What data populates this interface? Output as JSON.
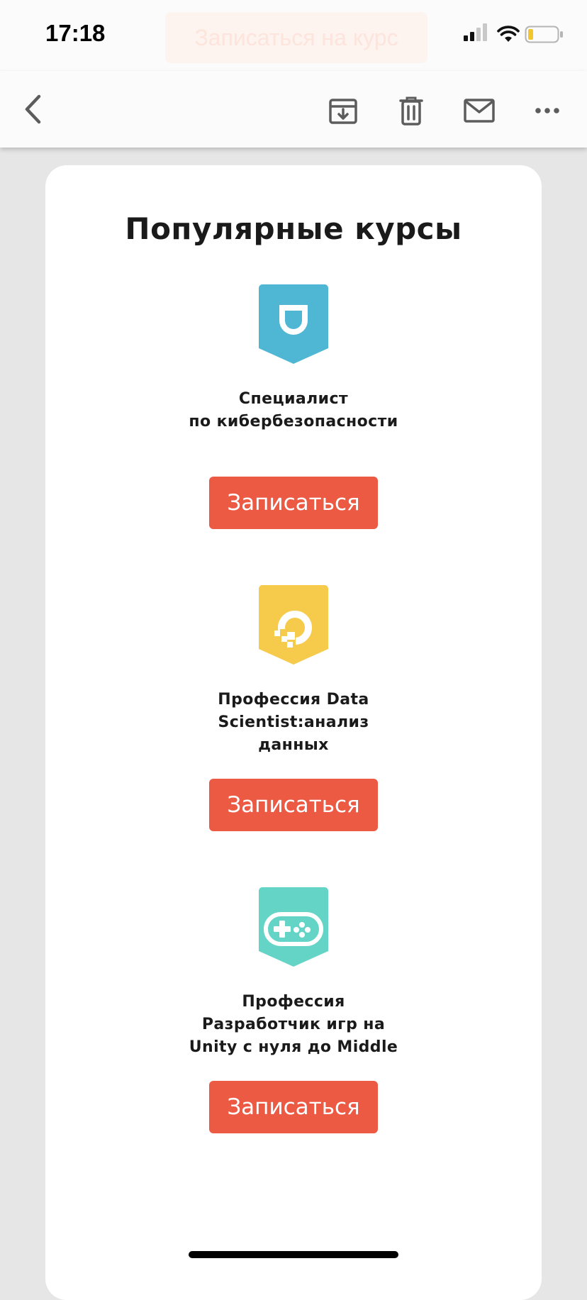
{
  "status_bar": {
    "time": "17:18",
    "signal_icon": "cellular-signal-icon",
    "wifi_icon": "wifi-icon",
    "battery_icon": "battery-low-icon"
  },
  "ghost_banner": {
    "label": "Записаться на курс"
  },
  "toolbar": {
    "back_icon": "chevron-left-icon",
    "archive_icon": "archive-icon",
    "delete_icon": "trash-icon",
    "mail_icon": "mail-icon",
    "more_icon": "ellipsis-icon"
  },
  "email": {
    "heading": "Популярные курсы",
    "courses": [
      {
        "title": "Специалист\nпо кибербезопасности",
        "button_label": "Записаться",
        "icon": "shield-icon",
        "color": "#4fb7d4"
      },
      {
        "title": "Профессия Data\nScientist:анализ\nданных",
        "button_label": "Записаться",
        "icon": "data-science-icon",
        "color": "#f6ca4a"
      },
      {
        "title": "Профессия\nРазработчик игр на\nUnity с нуля до Middle",
        "button_label": "Записаться",
        "icon": "gamepad-icon",
        "color": "#63d4c5"
      }
    ]
  },
  "colors": {
    "cta": "#ec5a43",
    "background": "#e6e6e6",
    "card": "#ffffff"
  }
}
